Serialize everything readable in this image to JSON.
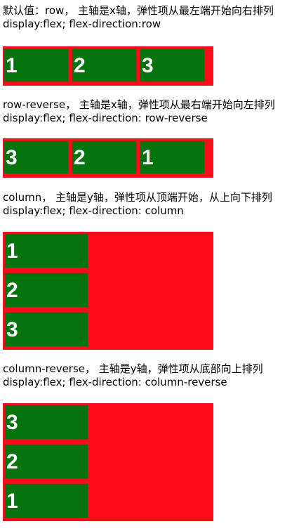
{
  "sections": [
    {
      "line1": "默认值：row， 主轴是x轴，弹性项从最左端开始向右排列",
      "line2": "display:flex; flex-direction:row",
      "items": [
        "1",
        "2",
        "3"
      ]
    },
    {
      "line1": "row-reverse， 主轴是x轴，弹性项从最右端开始向左排列",
      "line2": "display:flex; flex-direction: row-reverse",
      "items": [
        "3",
        "2",
        "1"
      ]
    },
    {
      "line1": "column， 主轴是y轴，弹性项从顶端开始，从上向下排列",
      "line2": "display:flex; flex-direction: column",
      "items": [
        "1",
        "2",
        "3"
      ]
    },
    {
      "line1": "column-reverse， 主轴是y轴，弹性项从底部向上排列",
      "line2": "display:flex; flex-direction: column-reverse",
      "items": [
        "3",
        "2",
        "1"
      ]
    }
  ],
  "colors": {
    "container_bg": "#ff0b1a",
    "item_bg": "#05730e",
    "item_text": "#ffffff"
  }
}
